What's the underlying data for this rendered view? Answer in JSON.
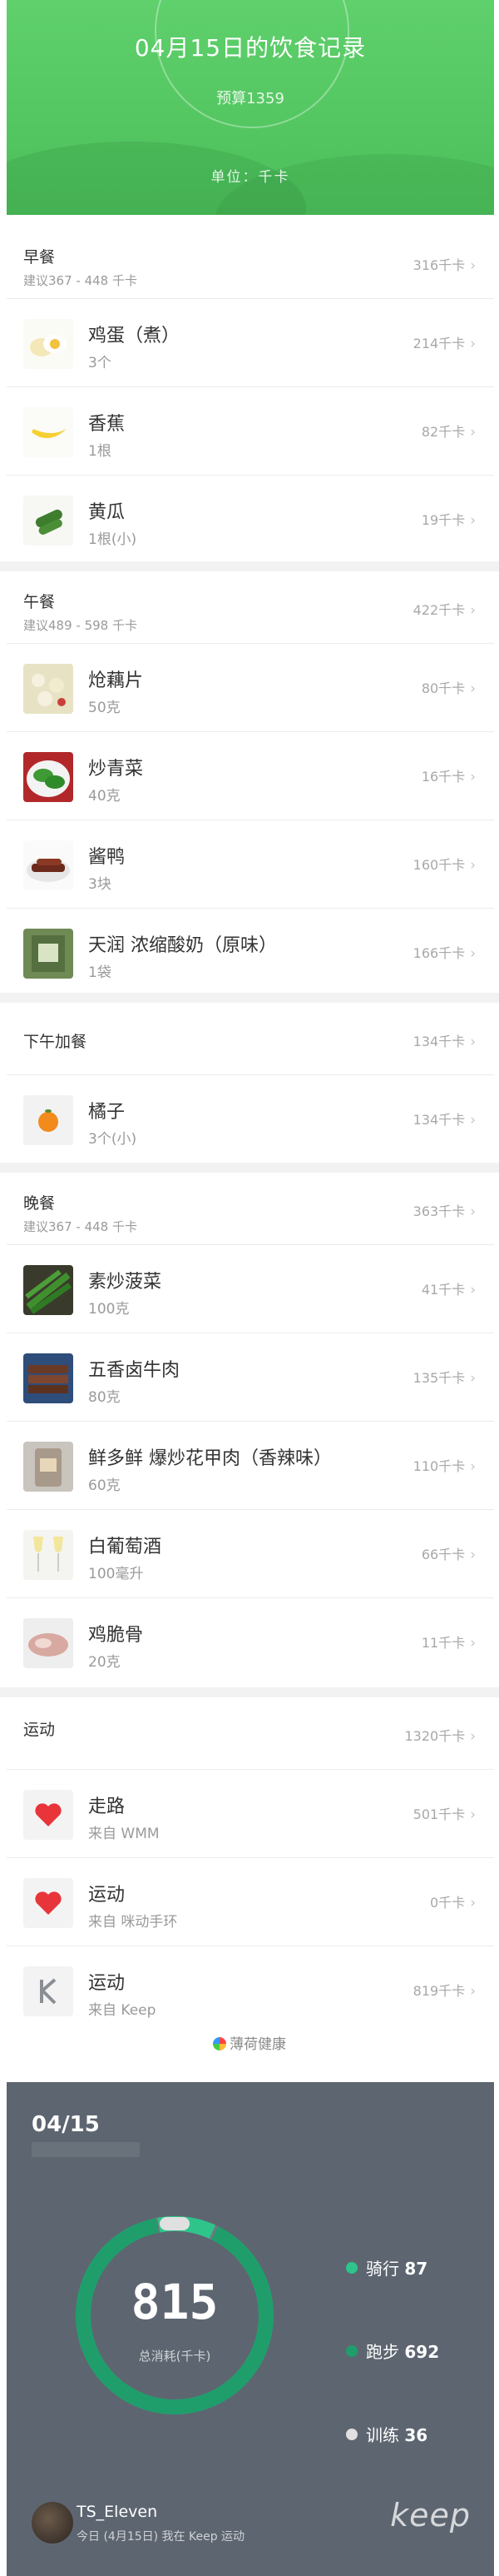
{
  "header": {
    "title": "04月15日的饮食记录",
    "budget": "预算1359",
    "unit": "单位：千卡"
  },
  "meals": [
    {
      "name": "早餐",
      "suggestion": "建议367 - 448 千卡",
      "total": "316千卡",
      "items": [
        {
          "name": "鸡蛋（煮）",
          "qty": "3个",
          "cal": "214千卡",
          "icon": "egg"
        },
        {
          "name": "香蕉",
          "qty": "1根",
          "cal": "82千卡",
          "icon": "banana"
        },
        {
          "name": "黄瓜",
          "qty": "1根(小)",
          "cal": "19千卡",
          "icon": "cucumber"
        }
      ]
    },
    {
      "name": "午餐",
      "suggestion": "建议489 - 598 千卡",
      "total": "422千卡",
      "items": [
        {
          "name": "炝藕片",
          "qty": "50克",
          "cal": "80千卡",
          "icon": "lotus-root"
        },
        {
          "name": "炒青菜",
          "qty": "40克",
          "cal": "16千卡",
          "icon": "greens"
        },
        {
          "name": "酱鸭",
          "qty": "3块",
          "cal": "160千卡",
          "icon": "duck"
        },
        {
          "name": "天润 浓缩酸奶（原味）",
          "qty": "1袋",
          "cal": "166千卡",
          "icon": "yogurt"
        }
      ]
    },
    {
      "name": "下午加餐",
      "suggestion": "",
      "total": "134千卡",
      "items": [
        {
          "name": "橘子",
          "qty": "3个(小)",
          "cal": "134千卡",
          "icon": "orange"
        }
      ]
    },
    {
      "name": "晚餐",
      "suggestion": "建议367 - 448 千卡",
      "total": "363千卡",
      "items": [
        {
          "name": "素炒菠菜",
          "qty": "100克",
          "cal": "41千卡",
          "icon": "spinach"
        },
        {
          "name": "五香卤牛肉",
          "qty": "80克",
          "cal": "135千卡",
          "icon": "beef"
        },
        {
          "name": "鲜多鲜 爆炒花甲肉（香辣味）",
          "qty": "60克",
          "cal": "110千卡",
          "icon": "clam"
        },
        {
          "name": "白葡萄酒",
          "qty": "100毫升",
          "cal": "66千卡",
          "icon": "wine"
        },
        {
          "name": "鸡脆骨",
          "qty": "20克",
          "cal": "11千卡",
          "icon": "chicken"
        }
      ]
    }
  ],
  "exercise": {
    "name": "运动",
    "total": "1320千卡",
    "items": [
      {
        "name": "走路",
        "qty": "来自 WMM",
        "cal": "501千卡",
        "icon": "heart"
      },
      {
        "name": "运动",
        "qty": "来自 咪动手环",
        "cal": "0千卡",
        "icon": "heart"
      },
      {
        "name": "运动",
        "qty": "来自 Keep",
        "cal": "819千卡",
        "icon": "keep-k"
      }
    ]
  },
  "brand": "薄荷健康",
  "keep": {
    "date": "04/15",
    "total": "815",
    "total_label": "总消耗(千卡)",
    "legend": [
      {
        "label": "骑行",
        "value": "87",
        "color": "#2ec48a"
      },
      {
        "label": "跑步",
        "value": "692",
        "color": "#1f9e6c"
      },
      {
        "label": "训练",
        "value": "36",
        "color": "#e0e0e0"
      }
    ],
    "user": "TS_Eleven",
    "user_sub": "今日 (4月15日) 我在 Keep 运动",
    "logo": "keep"
  }
}
